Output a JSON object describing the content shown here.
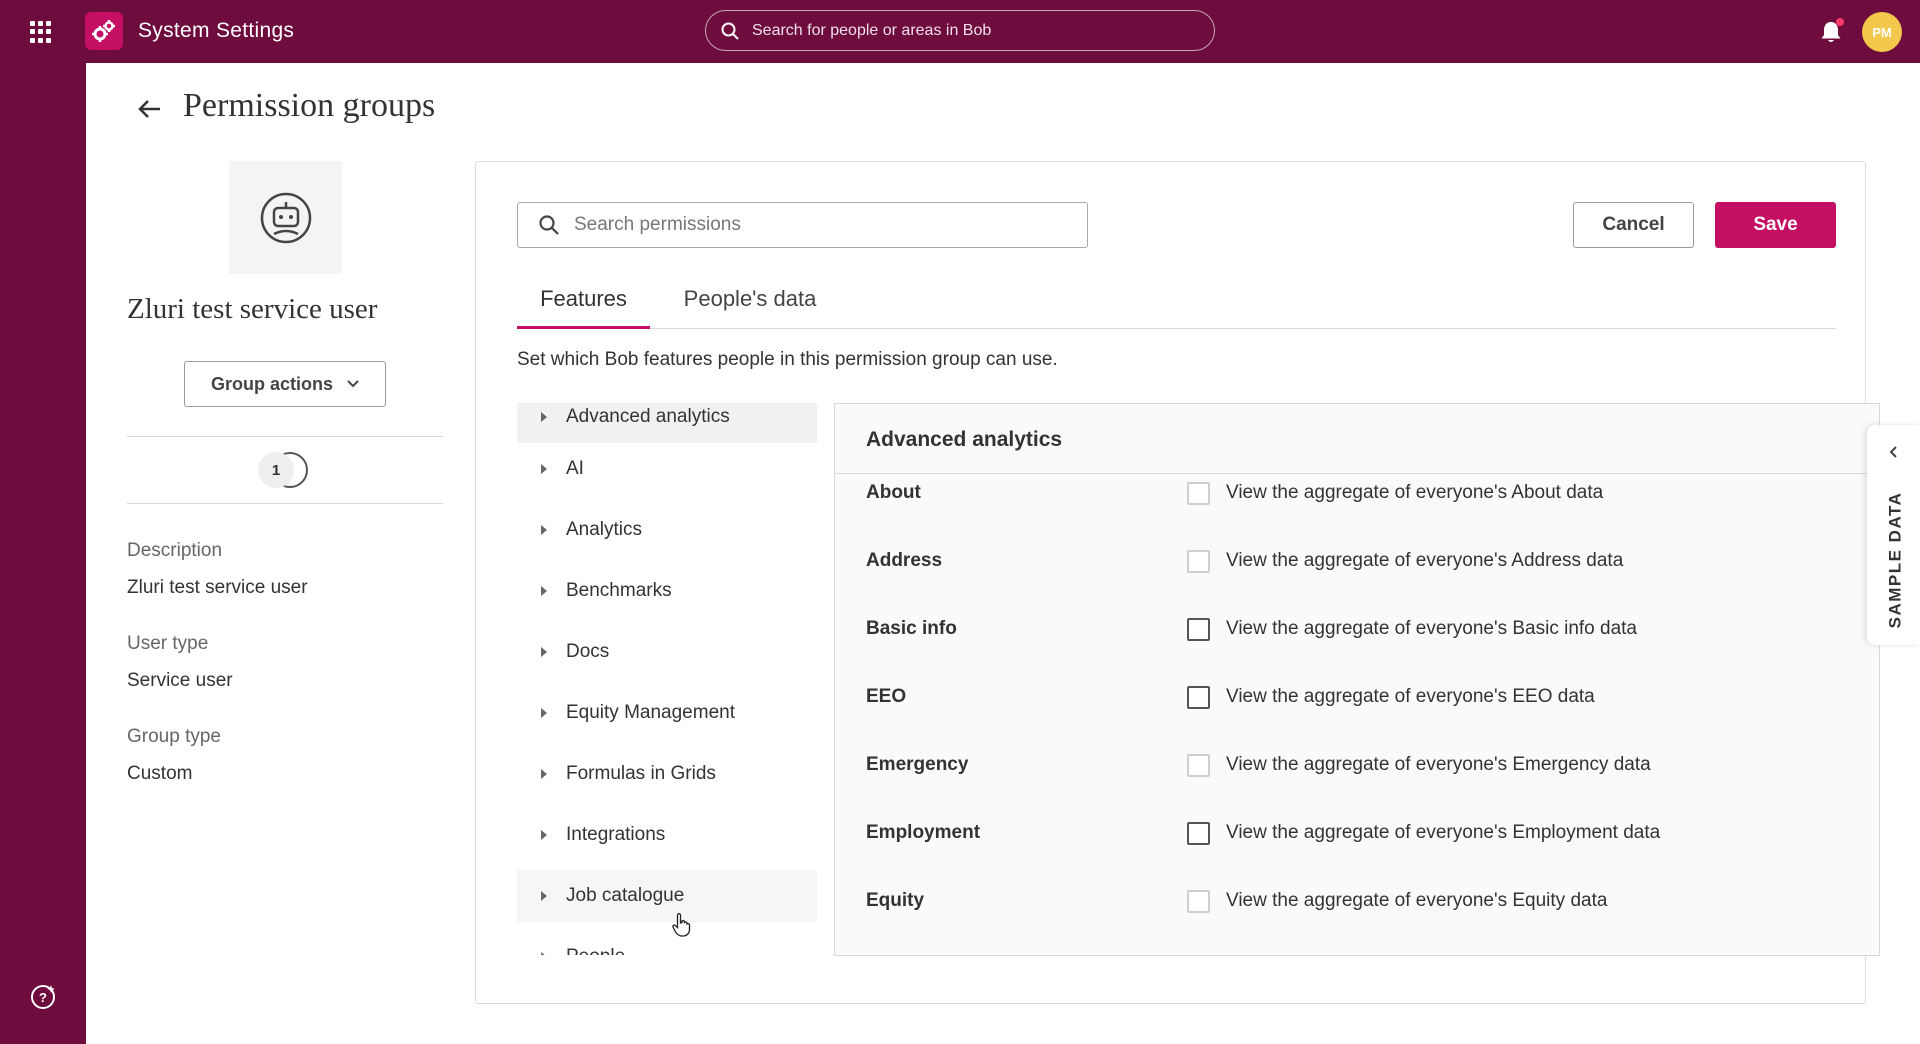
{
  "topbar": {
    "app_title": "System Settings",
    "search_placeholder": "Search for people or areas in Bob",
    "avatar_initials": "PM",
    "brand_color": "#6e0d3d",
    "accent_color": "#c40f64"
  },
  "page": {
    "title": "Permission groups"
  },
  "group": {
    "name": "Zluri test service user",
    "actions_label": "Group actions",
    "member_count": "1",
    "description_label": "Description",
    "description_value": "Zluri test service user",
    "user_type_label": "User type",
    "user_type_value": "Service user",
    "group_type_label": "Group type",
    "group_type_value": "Custom"
  },
  "permissions": {
    "search_placeholder": "Search permissions",
    "cancel_label": "Cancel",
    "save_label": "Save",
    "tabs": [
      {
        "label": "Features",
        "active": true
      },
      {
        "label": "People's data",
        "active": false
      }
    ],
    "description": "Set which Bob features people in this permission group can use.",
    "features": [
      {
        "label": "Advanced analytics"
      },
      {
        "label": "AI"
      },
      {
        "label": "Analytics"
      },
      {
        "label": "Benchmarks"
      },
      {
        "label": "Docs"
      },
      {
        "label": "Equity Management"
      },
      {
        "label": "Formulas in Grids"
      },
      {
        "label": "Integrations"
      },
      {
        "label": "Job catalogue"
      },
      {
        "label": "People"
      }
    ],
    "detail": {
      "title": "Advanced analytics",
      "rows": [
        {
          "name": "About",
          "text": "View the aggregate of everyone's About data",
          "checked": false
        },
        {
          "name": "Address",
          "text": "View the aggregate of everyone's Address data",
          "checked": false
        },
        {
          "name": "Basic info",
          "text": "View the aggregate of everyone's Basic info data",
          "checked": false
        },
        {
          "name": "EEO",
          "text": "View the aggregate of everyone's EEO data",
          "checked": false
        },
        {
          "name": "Emergency",
          "text": "View the aggregate of everyone's Emergency data",
          "checked": false
        },
        {
          "name": "Employment",
          "text": "View the aggregate of everyone's Employment data",
          "checked": false
        },
        {
          "name": "Equity",
          "text": "View the aggregate of everyone's Equity data",
          "checked": false
        }
      ]
    }
  },
  "side_tab": {
    "label": "SAMPLE DATA"
  }
}
